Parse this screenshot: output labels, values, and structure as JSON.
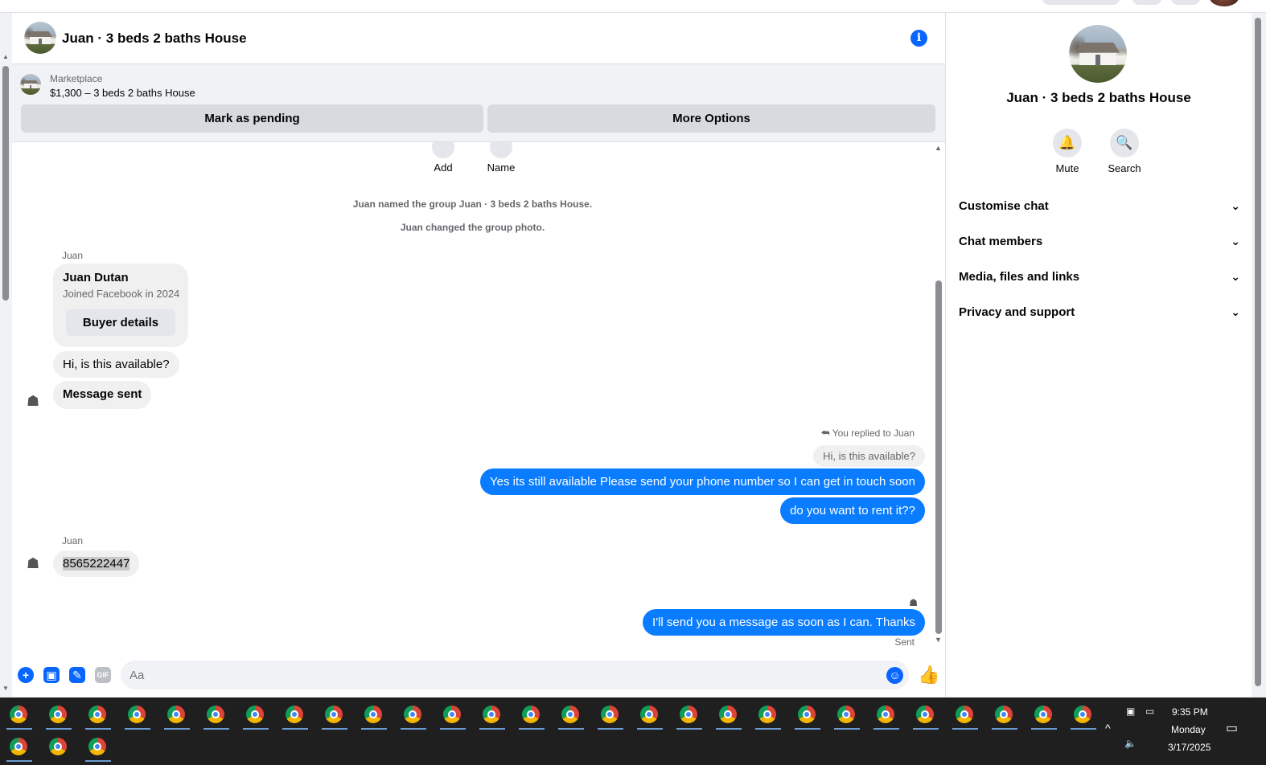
{
  "chat": {
    "title": "Juan · 3 beds 2 baths House",
    "info_icon": "info-icon",
    "marketplace": {
      "label": "Marketplace",
      "listing": "$1,300 – 3 beds 2 baths House",
      "pending_button": "Mark as pending",
      "options_button": "More Options"
    },
    "top_actions": [
      "Add",
      "Name"
    ],
    "system_messages": [
      "Juan named the group Juan · 3 beds 2 baths House.",
      "Juan changed the group photo."
    ],
    "sender_name": "Juan",
    "buyer_card": {
      "name": "Juan Dutan",
      "joined": "Joined Facebook in 2024",
      "button": "Buyer details"
    },
    "incoming_1": "Hi, is this available?",
    "incoming_2": "Message sent",
    "reply_note": "You replied to Juan",
    "reply_quote": "Hi, is this available?",
    "outgoing_1": "Yes its still available Please send your phone number so I can get in touch soon",
    "outgoing_2": "do you want to rent it??",
    "sender_name_2": "Juan",
    "incoming_3": "8565222447",
    "outgoing_3": "I'll send you a message as soon as I can. Thanks",
    "status": "Sent",
    "composer_placeholder": "Aa",
    "gif_label": "GIF"
  },
  "info_panel": {
    "title": "Juan · 3 beds 2 baths House",
    "actions": [
      {
        "label": "Mute",
        "icon": "bell-icon"
      },
      {
        "label": "Search",
        "icon": "search-icon"
      }
    ],
    "sections": [
      "Customise chat",
      "Chat members",
      "Media, files and links",
      "Privacy and support"
    ]
  },
  "taskbar": {
    "time": "9:35 PM",
    "day": "Monday",
    "date": "3/17/2025"
  },
  "colors": {
    "accent": "#0866ff",
    "bubble_out": "#0a7cff",
    "bubble_in": "#f0f0f0",
    "taskbar": "#1f1f1f"
  }
}
